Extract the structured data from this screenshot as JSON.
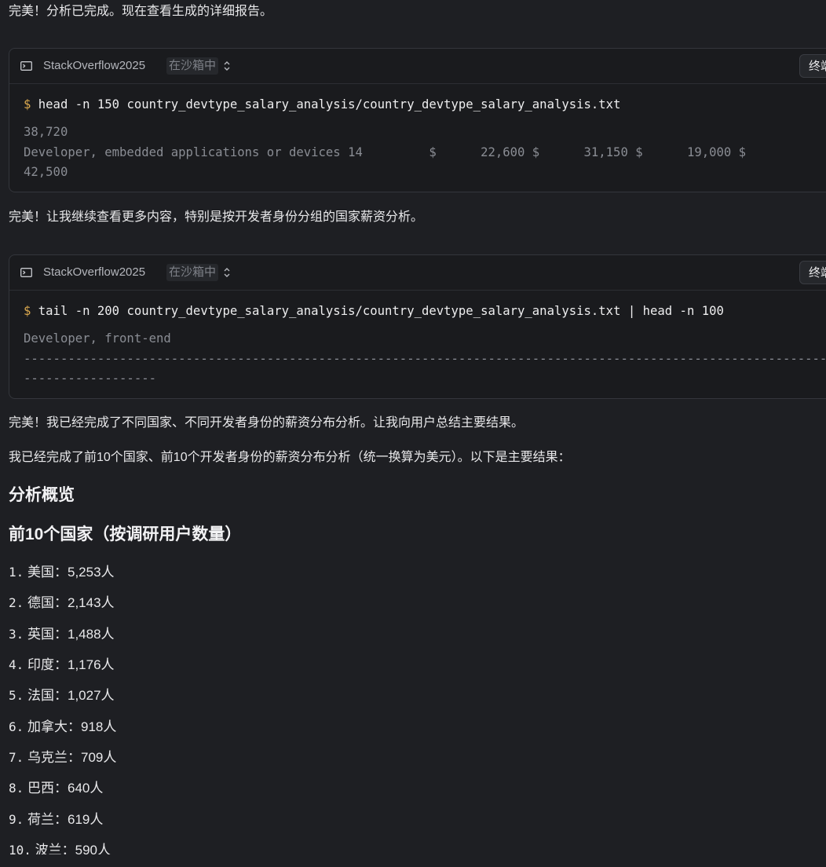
{
  "messages": {
    "m1": "完美！分析已完成。现在查看生成的详细报告。",
    "m2": "完美！让我继续查看更多内容，特别是按开发者身份分组的国家薪资分析。",
    "m3": "完美！我已经完成了不同国家、不同开发者身份的薪资分布分析。让我向用户总结主要结果。",
    "m4": "我已经完成了前10个国家、前10个开发者身份的薪资分布分析（统一换算为美元）。以下是主要结果："
  },
  "terminals": [
    {
      "name": "StackOverflow2025",
      "tag": "在沙箱中",
      "action": "终端",
      "prompt": "$",
      "command": "head -n 150 country_devtype_salary_analysis/country_devtype_salary_analysis.txt",
      "output": [
        "38,720",
        "Developer, embedded applications or devices 14         $      22,600 $      31,150 $      19,000 $",
        "42,500"
      ]
    },
    {
      "name": "StackOverflow2025",
      "tag": "在沙箱中",
      "action": "终端",
      "prompt": "$",
      "command": "tail -n 200 country_devtype_salary_analysis/country_devtype_salary_analysis.txt | head -n 100",
      "output": [
        "Developer, front-end",
        "--------------------------------------------------------------------------------------------------------------",
        "------------------"
      ]
    }
  ],
  "summary": {
    "heading": "分析概览",
    "subheading": "前10个国家（按调研用户数量）",
    "countries": [
      {
        "num": "1.",
        "text": "美国：5,253人"
      },
      {
        "num": "2.",
        "text": "德国：2,143人"
      },
      {
        "num": "3.",
        "text": "英国：1,488人"
      },
      {
        "num": "4.",
        "text": "印度：1,176人"
      },
      {
        "num": "5.",
        "text": "法国：1,027人"
      },
      {
        "num": "6.",
        "text": "加拿大：918人"
      },
      {
        "num": "7.",
        "text": "乌克兰：709人"
      },
      {
        "num": "8.",
        "text": "巴西：640人"
      },
      {
        "num": "9.",
        "text": "荷兰：619人"
      },
      {
        "num": "10.",
        "text": "波兰：590人"
      }
    ]
  }
}
